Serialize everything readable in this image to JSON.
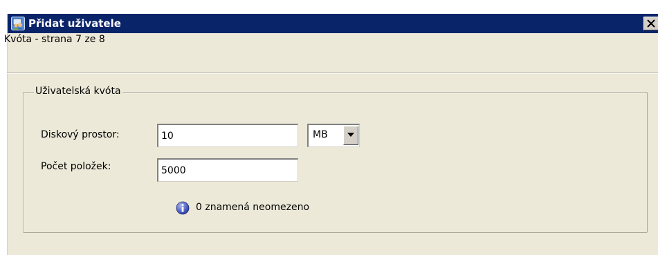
{
  "window": {
    "title": "Přidat uživatele",
    "page_label": "Kvóta - strana 7 ze 8",
    "title_color": "#0a246a",
    "app_icon": "users-app-icon",
    "close_icon": "close-icon"
  },
  "quota_group": {
    "legend": "Uživatelská kvóta",
    "disk_space": {
      "label": "Diskový prostor:",
      "value": "10",
      "unit": "MB"
    },
    "item_count": {
      "label": "Počet položek:",
      "value": "5000"
    },
    "hint": {
      "icon": "info-icon",
      "text": "0 znamená neomezeno"
    }
  }
}
